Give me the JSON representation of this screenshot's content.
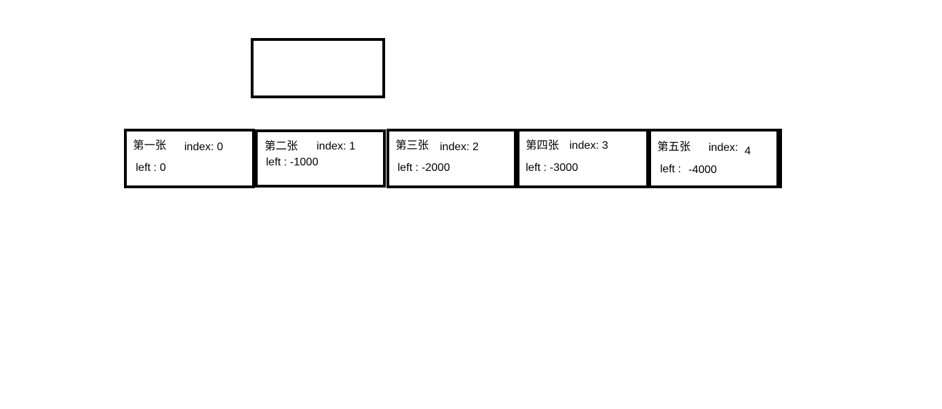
{
  "slides": [
    {
      "name_label": "第一张",
      "index_label": "index: 0",
      "left_label": "left : 0"
    },
    {
      "name_label": "第二张",
      "index_label": "index: 1",
      "left_label": "left : -1000"
    },
    {
      "name_label": "第三张",
      "index_label": "index: 2",
      "left_label": "left : -2000"
    },
    {
      "name_label": "第四张",
      "index_label": "index: 3",
      "left_label": "left : -3000"
    },
    {
      "name_label": "第五张",
      "index_label": "index:",
      "index_value": "4",
      "left_label": "left :",
      "left_value": "-4000"
    }
  ]
}
